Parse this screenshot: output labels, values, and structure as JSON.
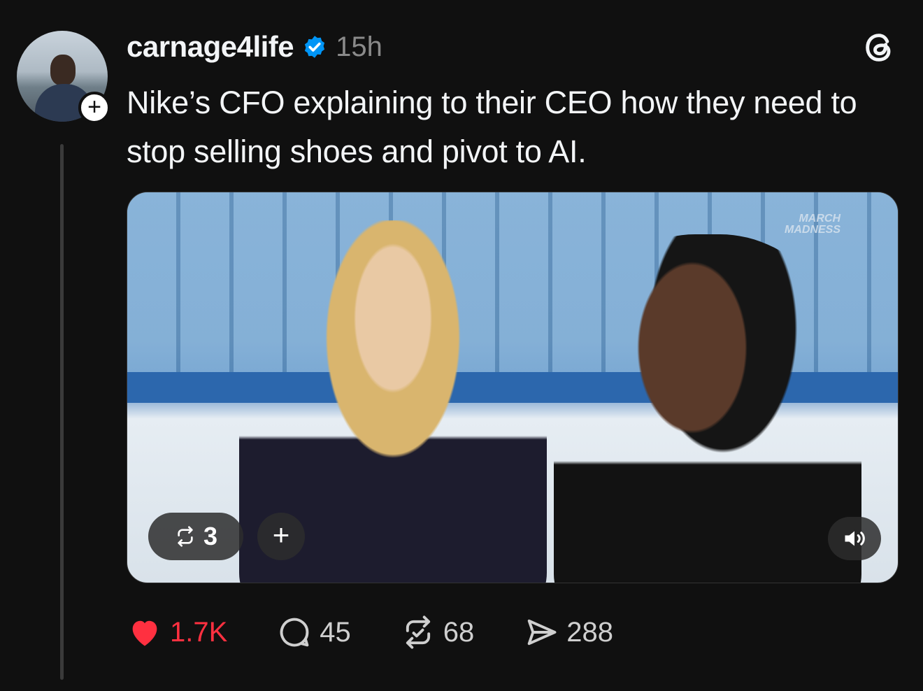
{
  "post": {
    "username": "carnage4life",
    "verified": true,
    "time": "15h",
    "text": "Nike’s CFO explaining to their CEO how they need to stop selling shoes and pivot to AI."
  },
  "media": {
    "repost_count": "3",
    "watermark_line1": "MARCH",
    "watermark_line2": "MADNESS"
  },
  "actions": {
    "likes": "1.7K",
    "comments": "45",
    "reposts": "68",
    "shares": "288"
  },
  "colors": {
    "background": "#101010",
    "verified_blue": "#0095f6",
    "like_red": "#ff3040",
    "text": "#f3f5f7",
    "muted": "#8a8a8a"
  },
  "icons": {
    "verified": "verified-badge-icon",
    "threads": "threads-logo-icon",
    "like": "heart-icon",
    "comment": "comment-icon",
    "repost": "repost-icon",
    "share": "share-icon",
    "sound": "speaker-icon"
  }
}
